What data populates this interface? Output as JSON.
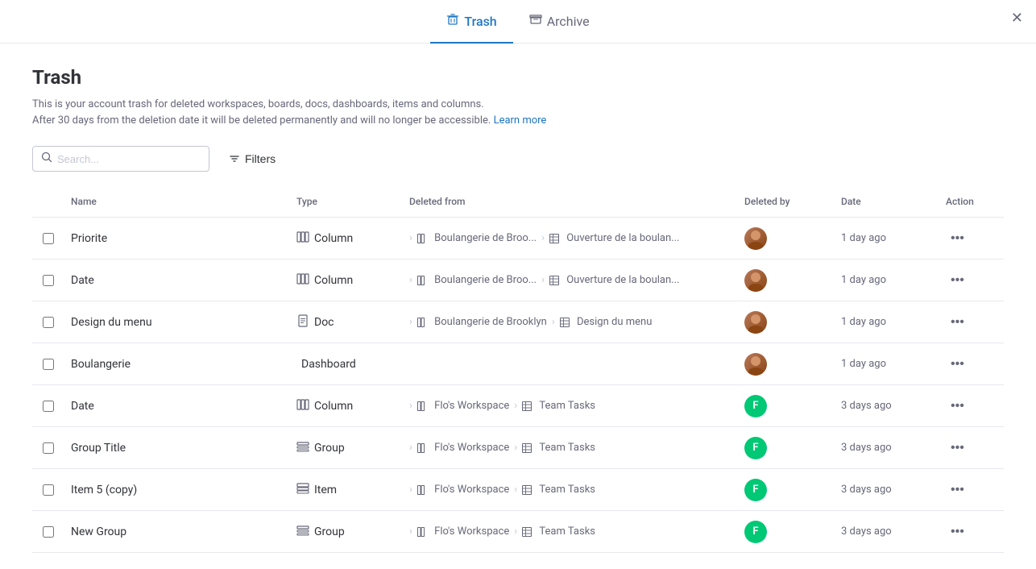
{
  "close_button_label": "×",
  "tabs": [
    {
      "id": "trash",
      "label": "Trash",
      "icon": "🗑",
      "active": true
    },
    {
      "id": "archive",
      "label": "Archive",
      "icon": "🗄",
      "active": false
    }
  ],
  "page": {
    "title": "Trash",
    "description_line1": "This is your account trash for deleted workspaces, boards, docs, dashboards, items and columns.",
    "description_line2": "After 30 days from the deletion date it will be deleted permanently and will no longer be accessible.",
    "learn_more_label": "Learn more"
  },
  "toolbar": {
    "search_placeholder": "Search...",
    "filters_label": "Filters"
  },
  "table": {
    "columns": [
      "",
      "Name",
      "Type",
      "Deleted from",
      "Deleted by",
      "Date",
      "Action"
    ],
    "rows": [
      {
        "name": "Priorite",
        "type": "Column",
        "deleted_from_1": "Boulangerie de Broo...",
        "deleted_from_2": "Ouverture de la boulan...",
        "deleted_by_initial": null,
        "deleted_by_photo": true,
        "date": "1 day ago"
      },
      {
        "name": "Date",
        "type": "Column",
        "deleted_from_1": "Boulangerie de Broo...",
        "deleted_from_2": "Ouverture de la boulan...",
        "deleted_by_initial": null,
        "deleted_by_photo": true,
        "date": "1 day ago"
      },
      {
        "name": "Design du menu",
        "type": "Doc",
        "deleted_from_1": "Boulangerie de Brooklyn",
        "deleted_from_2": "Design du menu",
        "deleted_by_initial": null,
        "deleted_by_photo": true,
        "date": "1 day ago"
      },
      {
        "name": "Boulangerie",
        "type": "Dashboard",
        "deleted_from_1": null,
        "deleted_from_2": null,
        "deleted_by_initial": null,
        "deleted_by_photo": true,
        "date": "1 day ago"
      },
      {
        "name": "Date",
        "type": "Column",
        "deleted_from_1": "Flo's Workspace",
        "deleted_from_2": "Team Tasks",
        "deleted_by_initial": "F",
        "deleted_by_photo": false,
        "date": "3 days ago"
      },
      {
        "name": "Group Title",
        "type": "Group",
        "deleted_from_1": "Flo's Workspace",
        "deleted_from_2": "Team Tasks",
        "deleted_by_initial": "F",
        "deleted_by_photo": false,
        "date": "3 days ago"
      },
      {
        "name": "Item 5 (copy)",
        "type": "Item",
        "deleted_from_1": "Flo's Workspace",
        "deleted_from_2": "Team Tasks",
        "deleted_by_initial": "F",
        "deleted_by_photo": false,
        "date": "3 days ago"
      },
      {
        "name": "New Group",
        "type": "Group",
        "deleted_from_1": "Flo's Workspace",
        "deleted_from_2": "Team Tasks",
        "deleted_by_initial": "F",
        "deleted_by_photo": false,
        "date": "3 days ago"
      }
    ]
  }
}
